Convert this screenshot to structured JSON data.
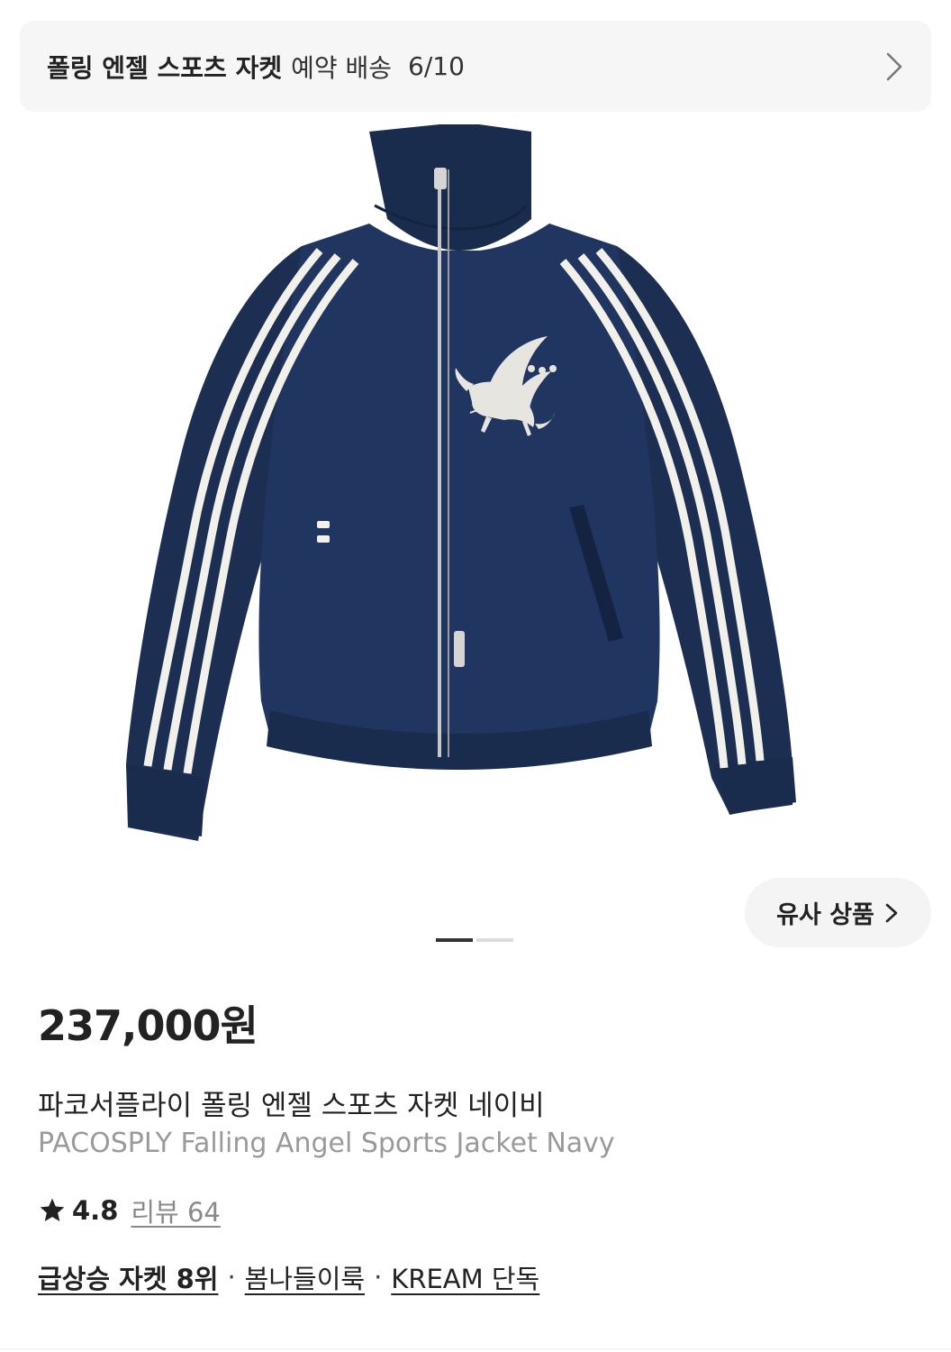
{
  "delivery_banner": {
    "title": "폴링 엔젤 스포츠 자켓",
    "subtitle": "예약 배송",
    "date": "6/10",
    "chevron_icon": "chevron-right-icon"
  },
  "product_image": {
    "icon": "jacket-illustration",
    "colors": {
      "navy": "#1c2f52",
      "stripe": "#f1f0eb",
      "zipper": "#c8c8c8"
    }
  },
  "similar_products": {
    "label": "유사 상품",
    "chevron_icon": "chevron-right-icon"
  },
  "pager": {
    "total": 2,
    "active": 1
  },
  "product": {
    "price": "237,000원",
    "name_ko": "파코서플라이 폴링 엔젤 스포츠 자켓 네이비",
    "name_en": "PACOSPLY Falling Angel Sports Jacket Navy",
    "rating": "4.8",
    "reviews": "리뷰 64",
    "tags": [
      {
        "label": "급상승 자켓 8위",
        "bold": true
      },
      {
        "label": "봄나들이룩",
        "bold": false
      },
      {
        "label": "KREAM 단독",
        "bold": false
      }
    ],
    "tag_separator": "·"
  }
}
